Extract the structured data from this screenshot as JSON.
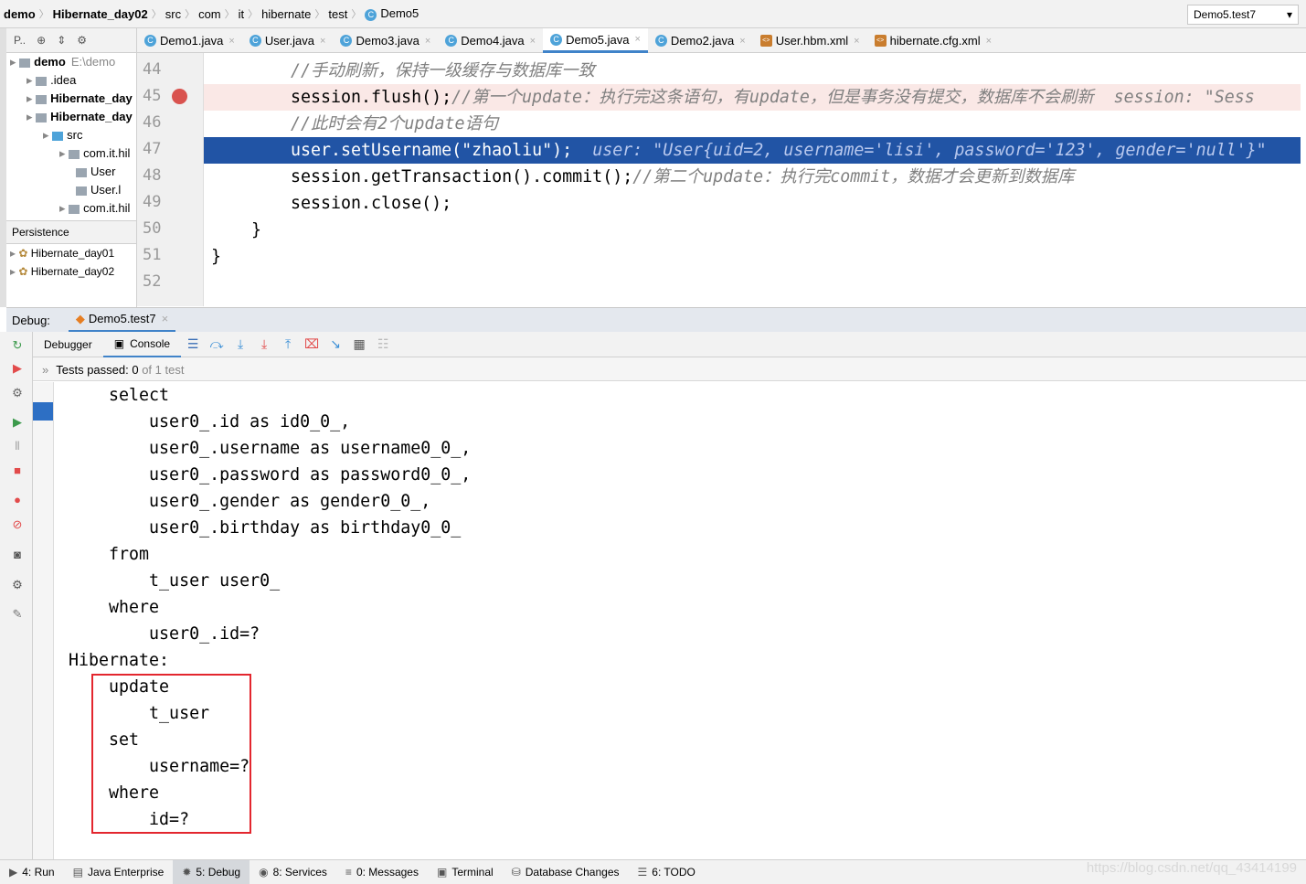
{
  "breadcrumb": [
    "demo",
    "Hibernate_day02",
    "src",
    "com",
    "it",
    "hibernate",
    "test",
    "Demo5"
  ],
  "run_config": "Demo5.test7",
  "project": {
    "toolbar_label": "P..",
    "tree": [
      {
        "label": "demo",
        "extra": "E:\\demo",
        "indent": 0,
        "bold": true
      },
      {
        "label": ".idea",
        "indent": 1
      },
      {
        "label": "Hibernate_day",
        "indent": 1,
        "bold": true
      },
      {
        "label": "Hibernate_day",
        "indent": 1,
        "bold": true
      },
      {
        "label": "src",
        "indent": 2
      },
      {
        "label": "com.it.hil",
        "indent": 3
      },
      {
        "label": "User",
        "indent": 4
      },
      {
        "label": "User.l",
        "indent": 4
      },
      {
        "label": "com.it.hil",
        "indent": 3
      }
    ],
    "persistence_label": "Persistence",
    "persistence_items": [
      "Hibernate_day01",
      "Hibernate_day02"
    ]
  },
  "tabs": [
    {
      "label": "Demo1.java"
    },
    {
      "label": "User.java"
    },
    {
      "label": "Demo3.java"
    },
    {
      "label": "Demo4.java"
    },
    {
      "label": "Demo5.java",
      "active": true
    },
    {
      "label": "Demo2.java"
    },
    {
      "label": "User.hbm.xml"
    },
    {
      "label": "hibernate.cfg.xml"
    }
  ],
  "editor": {
    "lines": [
      {
        "n": "44",
        "code": "",
        "comment": "//手动刷新，保持一级缓存与数据库一致",
        "indent": "        "
      },
      {
        "n": "45",
        "code": "session.flush();",
        "comment": "//第一个update：执行完这条语句，有update，但是事务没有提交，数据库不会刷新  session: \"Sess",
        "indent": "        ",
        "breakpoint": true
      },
      {
        "n": "46",
        "code": "",
        "comment": "//此时会有2个update语句",
        "indent": "        "
      },
      {
        "n": "47",
        "code": "user.setUsername(\"zhaoliu\");",
        "comment": "  user: \"User{uid=2, username='lisi', password='123', gender='null'}\"",
        "indent": "        ",
        "current": true
      },
      {
        "n": "48",
        "code": "session.getTransaction().commit();",
        "comment": "//第二个update：执行完commit，数据才会更新到数据库",
        "indent": "        "
      },
      {
        "n": "49",
        "code": "session.close();",
        "comment": "",
        "indent": "        "
      },
      {
        "n": "50",
        "code": "}",
        "comment": "",
        "indent": "    "
      },
      {
        "n": "51",
        "code": "}",
        "comment": "",
        "indent": ""
      },
      {
        "n": "52",
        "code": "",
        "comment": "",
        "indent": ""
      }
    ]
  },
  "debug": {
    "label": "Debug:",
    "session": "Demo5.test7",
    "tabs": [
      "Debugger",
      "Console"
    ],
    "tests_prefix": "Tests passed: ",
    "tests_count": "0",
    "tests_suffix": " of 1 test"
  },
  "console": [
    "    select",
    "        user0_.id as id0_0_,",
    "        user0_.username as username0_0_,",
    "        user0_.password as password0_0_,",
    "        user0_.gender as gender0_0_,",
    "        user0_.birthday as birthday0_0_",
    "    from",
    "        t_user user0_",
    "    where",
    "        user0_.id=?",
    "Hibernate: ",
    "    update",
    "        t_user",
    "    set",
    "        username=?",
    "    where",
    "        id=?"
  ],
  "statusbar": [
    "4: Run",
    "Java Enterprise",
    "5: Debug",
    "8: Services",
    "0: Messages",
    "Terminal",
    "Database Changes",
    "6: TODO"
  ],
  "watermark": "https://blog.csdn.net/qq_43414199"
}
